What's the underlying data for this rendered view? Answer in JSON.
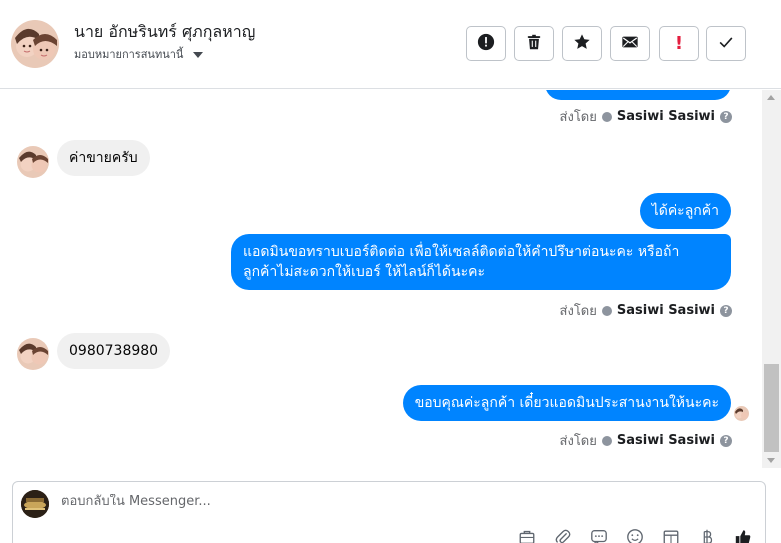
{
  "header": {
    "contact_name": "นาย อักษรินทร์ ศุภกุลหาญ",
    "assign_label": "มอบหมายการสนทนานี้",
    "buttons": [
      {
        "icon": "alert-circle-icon"
      },
      {
        "icon": "trash-icon"
      },
      {
        "icon": "star-icon"
      },
      {
        "icon": "envelope-icon"
      },
      {
        "icon": "exclamation-icon",
        "label": "!"
      },
      {
        "icon": "checkmark-icon"
      }
    ]
  },
  "messages": [
    {
      "direction": "out",
      "text": "",
      "partial": true
    },
    {
      "sent_by_prefix": "ส่งโดย",
      "sent_by_name": "Sasiwi Sasiwi"
    },
    {
      "direction": "in",
      "text": "ค่าขายครับ"
    },
    {
      "direction": "out",
      "text": "ได้ค่ะลูกค้า"
    },
    {
      "direction": "out",
      "text_line1": "แอดมินขอทราบเบอร์ติดต่อ เพื่อให้เซลล์ติดต่อให้คำปรึษาต่อนะคะ หรือถ้า",
      "text_line2": "ลูกค้าไม่สะดวกให้เบอร์ ให้ไลน์ก็ได้นะคะ"
    },
    {
      "sent_by_prefix": "ส่งโดย",
      "sent_by_name": "Sasiwi Sasiwi"
    },
    {
      "direction": "in",
      "text": "0980738980"
    },
    {
      "direction": "out",
      "text": "ขอบคุณค่ะลูกค้า เดี๋ยวแอดมินประสานงานให้นะคะ"
    },
    {
      "sent_by_prefix": "ส่งโดย",
      "sent_by_name": "Sasiwi Sasiwi"
    }
  ],
  "composer": {
    "placeholder": "ตอบกลับใน Messenger..."
  },
  "colors": {
    "outgoing_bubble": "#0084ff",
    "incoming_bubble": "#f0f0f0",
    "alert_red": "#e41e3f"
  }
}
